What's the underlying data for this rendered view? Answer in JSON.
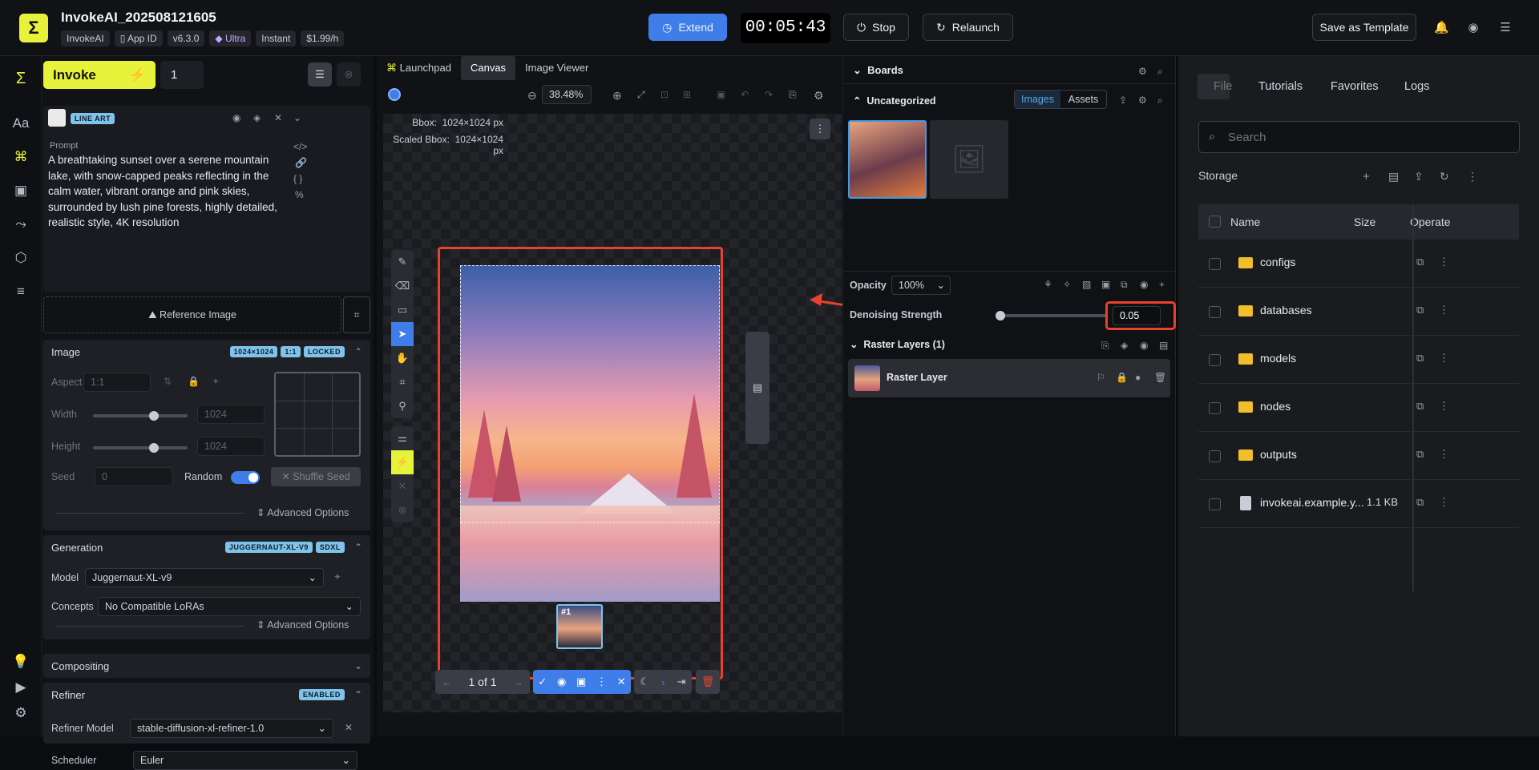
{
  "app": {
    "title": "InvokeAI_202508121605",
    "tags": [
      "InvokeAI",
      "App ID",
      "v6.3.0",
      "Ultra",
      "Instant",
      "$1.99/h"
    ]
  },
  "top": {
    "extend": "Extend",
    "timer": "00:05:43",
    "stop": "Stop",
    "relaunch": "Relaunch",
    "save_template": "Save as Template"
  },
  "left": {
    "invoke": "Invoke",
    "count": "1",
    "lineart": "LINE ART",
    "prompt_label": "Prompt",
    "prompt": "A breathtaking sunset over a serene mountain lake, with snow-capped peaks reflecting in the calm water, vibrant orange and pink skies, surrounded by lush pine forests, highly detailed, realistic style, 4K resolution",
    "reference_image": "Reference Image",
    "image": {
      "title": "Image",
      "badges": [
        "1024×1024",
        "1:1",
        "LOCKED"
      ],
      "aspect_label": "Aspect",
      "aspect": "1:1",
      "width_label": "Width",
      "width": "1024",
      "height_label": "Height",
      "height": "1024",
      "seed_label": "Seed",
      "seed": "0",
      "random": "Random",
      "shuffle": "Shuffle Seed",
      "advanced": "Advanced Options"
    },
    "generation": {
      "title": "Generation",
      "badges": [
        "JUGGERNAUT-XL-V9",
        "SDXL"
      ],
      "model_label": "Model",
      "model": "Juggernaut-XL-v9",
      "concepts_label": "Concepts",
      "concepts": "No Compatible LoRAs",
      "advanced": "Advanced Options"
    },
    "compositing": "Compositing",
    "refiner": {
      "title": "Refiner",
      "badge": "ENABLED",
      "model_label": "Refiner Model",
      "model": "stable-diffusion-xl-refiner-1.0",
      "scheduler_label": "Scheduler",
      "scheduler": "Euler"
    }
  },
  "canvas": {
    "tabs": [
      "Launchpad",
      "Canvas",
      "Image Viewer"
    ],
    "zoom": "38.48%",
    "bbox_label": "Bbox:",
    "bbox": "1024×1024 px",
    "scaled_label": "Scaled Bbox:",
    "scaled": "1024×1024 px",
    "thumb_label": "#1",
    "pager": "1 of 1"
  },
  "boards": {
    "title": "Boards",
    "board": "Uncategorized",
    "tab_images": "Images",
    "tab_assets": "Assets",
    "opacity_label": "Opacity",
    "opacity": "100%",
    "denoise_label": "Denoising Strength",
    "denoise": "0.05",
    "layers_title": "Raster Layers (1)",
    "layer": "Raster Layer"
  },
  "files": {
    "tabs": [
      "File",
      "Tutorials",
      "Favorites",
      "Logs"
    ],
    "search_placeholder": "Search",
    "storage": "Storage",
    "col_name": "Name",
    "col_size": "Size",
    "col_operate": "Operate",
    "rows": [
      {
        "name": "configs",
        "size": ""
      },
      {
        "name": "databases",
        "size": ""
      },
      {
        "name": "models",
        "size": ""
      },
      {
        "name": "nodes",
        "size": ""
      },
      {
        "name": "outputs",
        "size": ""
      },
      {
        "name": "invokeai.example.y...",
        "size": "1.1 KB"
      }
    ]
  },
  "colors": {
    "accent": "#e7f23a",
    "blue": "#3f7ee8",
    "highlight": "#e8412c"
  }
}
